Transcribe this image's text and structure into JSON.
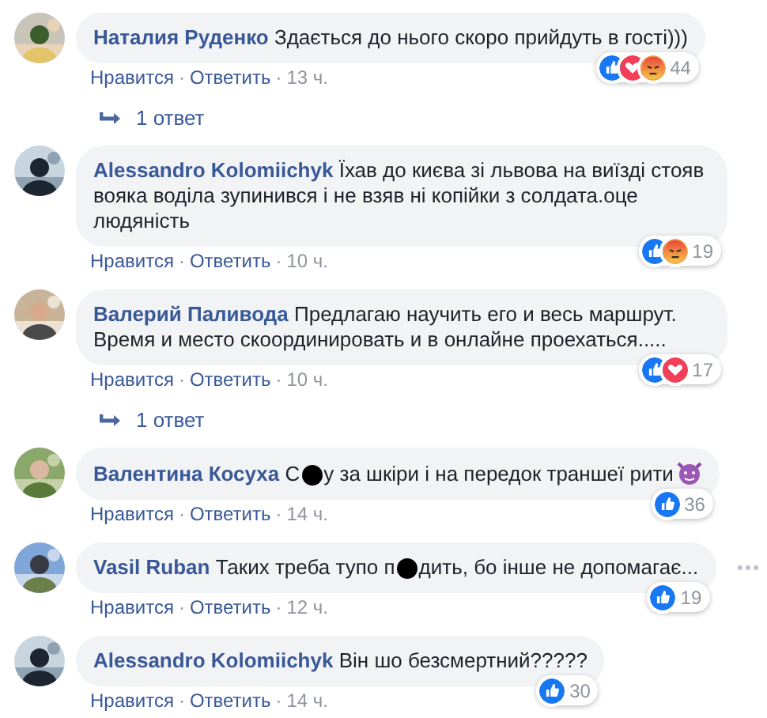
{
  "comments": [
    {
      "author": "Наталия Руденко",
      "text_parts": [
        "Здається до нього скоро прийдуть в гості)))"
      ],
      "emoji": false,
      "menu": false,
      "reactions": [
        {
          "kind": "like"
        },
        {
          "kind": "love"
        },
        {
          "kind": "angry"
        }
      ],
      "reaction_count": "44",
      "actions": [
        "Нравится",
        "Ответить"
      ],
      "separator": "·",
      "time": "13 ч.",
      "replies": "1 ответ"
    },
    {
      "author": "Alessandro Kolomiichyk",
      "text_parts": [
        "Їхав до києва зі львова на виїзді стояв вояка воділа зупинився і не взяв ні копійки з солдата.оце людяність"
      ],
      "emoji": false,
      "menu": false,
      "reactions": [
        {
          "kind": "like"
        },
        {
          "kind": "angry"
        }
      ],
      "reaction_count": "19",
      "actions": [
        "Нравится",
        "Ответить"
      ],
      "separator": "·",
      "time": "10 ч."
    },
    {
      "author": "Валерий Паливода",
      "text_parts": [
        "Предлагаю научить его и весь маршрут. Время и место скоординировать и в онлайне проехаться....."
      ],
      "emoji": false,
      "menu": false,
      "reactions": [
        {
          "kind": "like"
        },
        {
          "kind": "love"
        }
      ],
      "reaction_count": "17",
      "actions": [
        "Нравится",
        "Ответить"
      ],
      "separator": "·",
      "time": "10 ч.",
      "replies": "1 ответ"
    },
    {
      "author": "Валентина Косуха",
      "text_parts": [
        "С",
        "у за шкіри і на передок траншеї рити"
      ],
      "emoji": true,
      "menu": false,
      "reactions": [
        {
          "kind": "like"
        }
      ],
      "reaction_count": "36",
      "actions": [
        "Нравится",
        "Ответить"
      ],
      "separator": "·",
      "time": "14 ч."
    },
    {
      "author": "Vasil Ruban",
      "text_parts": [
        "Таких треба тупо п",
        "дить, бо інше не допомагає..."
      ],
      "emoji": false,
      "menu": true,
      "reactions": [
        {
          "kind": "like"
        }
      ],
      "reaction_count": "19",
      "actions": [
        "Нравится",
        "Ответить"
      ],
      "separator": "·",
      "time": "12 ч."
    },
    {
      "author": "Alessandro Kolomiichyk",
      "text_parts": [
        "Він шо безсмертний?????"
      ],
      "emoji": false,
      "menu": false,
      "reactions": [
        {
          "kind": "like"
        }
      ],
      "reaction_count": "30",
      "actions": [
        "Нравится",
        "Ответить"
      ],
      "separator": "·",
      "time": "14 ч."
    }
  ]
}
